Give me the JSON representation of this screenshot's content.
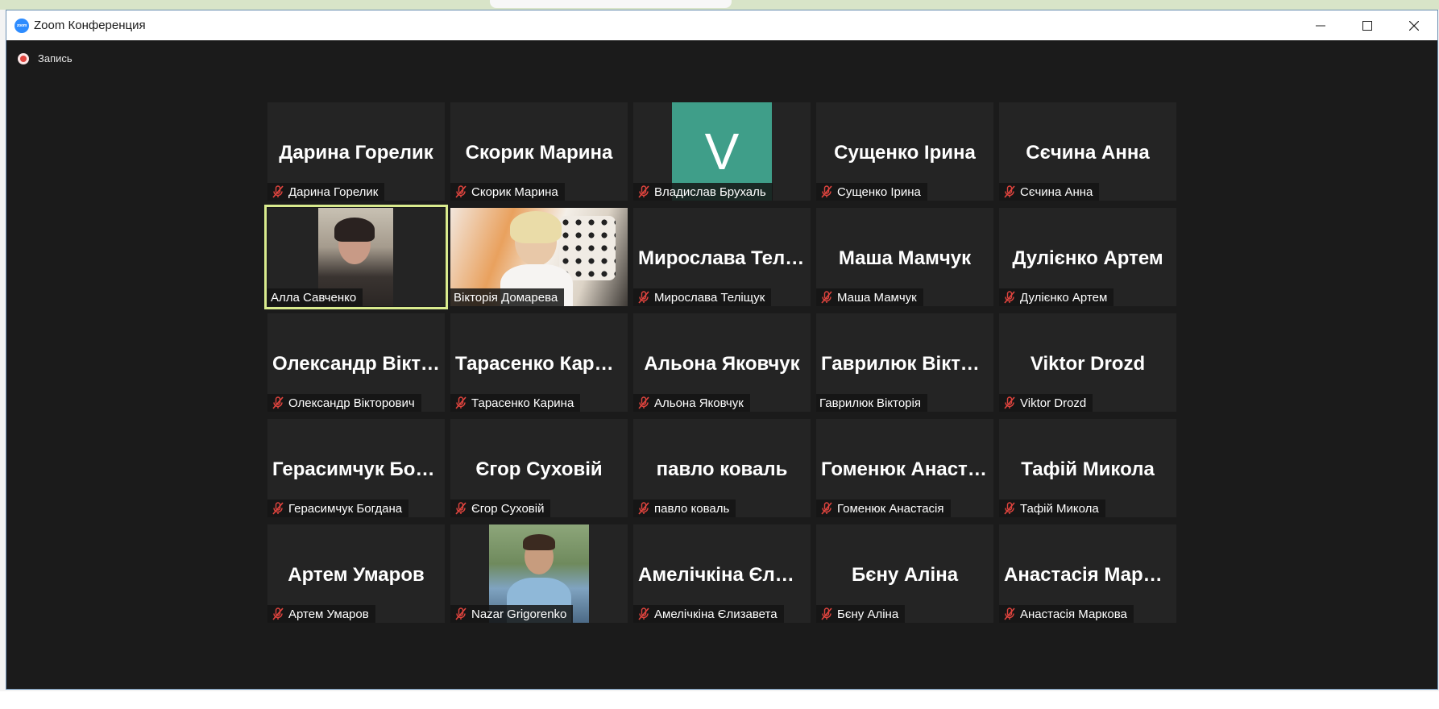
{
  "window": {
    "title": "Zoom Конференция",
    "logo_text": "zoom"
  },
  "recording": {
    "label": "Запись"
  },
  "colors": {
    "tile_bg": "#242424",
    "active_border": "#d9eb8e",
    "avatar_v": "#3f9e89",
    "mute_red": "#e0443e"
  },
  "participants": [
    {
      "display_name": "Дарина Горелик",
      "label": "Дарина Горелик",
      "muted": true,
      "view": "name"
    },
    {
      "display_name": "Скорик Марина",
      "label": "Скорик Марина",
      "muted": true,
      "view": "name"
    },
    {
      "display_name": "V",
      "label": "Владислав Брухаль",
      "muted": true,
      "view": "avatar"
    },
    {
      "display_name": "Сущенко Ірина",
      "label": "Сущенко Ірина",
      "muted": true,
      "view": "name"
    },
    {
      "display_name": "Сєчина Анна",
      "label": "Сєчина Анна",
      "muted": true,
      "view": "name"
    },
    {
      "display_name": "",
      "label": "Алла Савченко",
      "muted": false,
      "view": "video",
      "active": true
    },
    {
      "display_name": "",
      "label": "Вікторія Домарева",
      "muted": false,
      "view": "video"
    },
    {
      "display_name": "Мирослава Теліщук",
      "label": "Мирослава Теліщук",
      "muted": true,
      "view": "name"
    },
    {
      "display_name": "Маша Мамчук",
      "label": "Маша Мамчук",
      "muted": true,
      "view": "name"
    },
    {
      "display_name": "Дулієнко Артем",
      "label": "Дулієнко Артем",
      "muted": true,
      "view": "name"
    },
    {
      "display_name": "Олександр Вікторович",
      "label": "Олександр Вікторович",
      "muted": true,
      "view": "name"
    },
    {
      "display_name": "Тарасенко Карина",
      "label": "Тарасенко Карина",
      "muted": true,
      "view": "name"
    },
    {
      "display_name": "Альона Яковчук",
      "label": "Альона Яковчук",
      "muted": true,
      "view": "name"
    },
    {
      "display_name": "Гаврилюк Вікторія",
      "label": "Гаврилюк Вікторія",
      "muted": false,
      "view": "name"
    },
    {
      "display_name": "Viktor Drozd",
      "label": "Viktor Drozd",
      "muted": true,
      "view": "name"
    },
    {
      "display_name": "Герасимчук Богдана",
      "label": "Герасимчук Богдана",
      "muted": true,
      "view": "name"
    },
    {
      "display_name": "Єгор Суховій",
      "label": "Єгор Суховій",
      "muted": true,
      "view": "name"
    },
    {
      "display_name": "павло коваль",
      "label": "павло коваль",
      "muted": true,
      "view": "name"
    },
    {
      "display_name": "Гоменюк Анастасія",
      "label": "Гоменюк Анастасія",
      "muted": true,
      "view": "name"
    },
    {
      "display_name": "Тафій Микола",
      "label": "Тафій Микола",
      "muted": true,
      "view": "name"
    },
    {
      "display_name": "Артем Умаров",
      "label": "Артем Умаров",
      "muted": true,
      "view": "name"
    },
    {
      "display_name": "",
      "label": "Nazar Grigorenko",
      "muted": true,
      "view": "video"
    },
    {
      "display_name": "Амелічкіна Єлизавета",
      "label": "Амелічкіна Єлизавета",
      "muted": true,
      "view": "name"
    },
    {
      "display_name": "Бєну Аліна",
      "label": "Бєну Аліна",
      "muted": true,
      "view": "name"
    },
    {
      "display_name": "Анастасія Маркова",
      "label": "Анастасія Маркова",
      "muted": true,
      "view": "name"
    }
  ]
}
